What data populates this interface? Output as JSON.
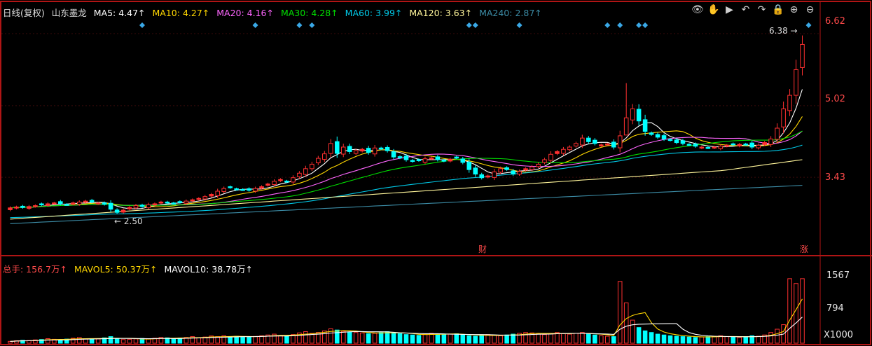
{
  "header": {
    "period": "日线(复权)",
    "stock_name": "山东墨龙",
    "ma": [
      {
        "label": "MA5: 4.47↑",
        "color": "#ffffff"
      },
      {
        "label": "MA10: 4.27↑",
        "color": "#ffd700"
      },
      {
        "label": "MA20: 4.16↑",
        "color": "#ff66ff"
      },
      {
        "label": "MA30: 4.28↑",
        "color": "#00e000"
      },
      {
        "label": "MA60: 3.99↑",
        "color": "#00c8e6"
      },
      {
        "label": "MA120: 3.63↑",
        "color": "#fff59a"
      },
      {
        "label": "MA240: 2.87↑",
        "color": "#3c8ca6"
      }
    ]
  },
  "toolbar": {
    "icons": [
      "eye-icon",
      "hand-icon",
      "play-icon",
      "undo-icon",
      "redo-icon",
      "lock-icon",
      "zoom-in-icon",
      "zoom-out-icon"
    ]
  },
  "price_axis": {
    "ticks": [
      "6.62",
      "5.02",
      "3.43"
    ]
  },
  "annotations": {
    "high_price": "6.38",
    "low_price": "2.50",
    "marker_cai": "财",
    "marker_zhang": "涨"
  },
  "volume": {
    "legend": [
      {
        "label": "总手: 156.7万↑",
        "color": "#ff4a4a"
      },
      {
        "label": "MAVOL5: 50.37万↑",
        "color": "#ffd700"
      },
      {
        "label": "MAVOL10: 38.78万↑",
        "color": "#ffffff"
      }
    ],
    "ticks": [
      "1567",
      "794",
      "X1000"
    ]
  },
  "chart_data": {
    "type": "candlestick",
    "price_ylim": [
      2.0,
      6.9
    ],
    "volume_ylim": [
      0,
      1650
    ],
    "colors": {
      "up": "#ff3030",
      "down": "#00ffff",
      "background": "#000000"
    },
    "diamond_markers": [
      21,
      39,
      46,
      48,
      73,
      74,
      81,
      95,
      97,
      100,
      101,
      127
    ],
    "closes": [
      2.75,
      2.77,
      2.76,
      2.78,
      2.8,
      2.82,
      2.84,
      2.86,
      2.84,
      2.82,
      2.86,
      2.88,
      2.9,
      2.88,
      2.86,
      2.83,
      2.72,
      2.65,
      2.7,
      2.76,
      2.8,
      2.78,
      2.82,
      2.84,
      2.88,
      2.86,
      2.85,
      2.87,
      2.9,
      2.93,
      2.96,
      3.0,
      3.05,
      3.12,
      3.18,
      3.2,
      3.16,
      3.15,
      3.14,
      3.18,
      3.22,
      3.28,
      3.34,
      3.38,
      3.33,
      3.42,
      3.52,
      3.62,
      3.72,
      3.85,
      3.95,
      4.18,
      3.96,
      4.1,
      4.0,
      4.02,
      4.05,
      3.98,
      4.08,
      4.06,
      4.02,
      3.88,
      3.86,
      3.82,
      3.78,
      3.8,
      3.84,
      3.86,
      3.82,
      3.79,
      3.83,
      3.86,
      3.76,
      3.6,
      3.5,
      3.42,
      3.46,
      3.55,
      3.62,
      3.6,
      3.5,
      3.56,
      3.62,
      3.66,
      3.72,
      3.82,
      3.94,
      4.0,
      4.05,
      4.1,
      4.18,
      4.3,
      4.22,
      4.18,
      4.15,
      4.17,
      4.1,
      4.35,
      4.75,
      4.95,
      4.68,
      4.45,
      4.38,
      4.32,
      4.28,
      4.25,
      4.2,
      4.18,
      4.15,
      4.12,
      4.1,
      4.08,
      4.1,
      4.12,
      4.14,
      4.15,
      4.16,
      4.15,
      4.1,
      4.14,
      4.2,
      4.28,
      4.52,
      4.95,
      5.25,
      5.82,
      6.38
    ],
    "volumes": [
      45,
      60,
      70,
      65,
      80,
      90,
      110,
      95,
      85,
      100,
      120,
      140,
      110,
      95,
      105,
      130,
      160,
      110,
      90,
      95,
      105,
      115,
      100,
      120,
      140,
      130,
      115,
      125,
      140,
      160,
      130,
      150,
      175,
      160,
      180,
      155,
      170,
      160,
      150,
      165,
      180,
      200,
      220,
      190,
      170,
      210,
      250,
      280,
      240,
      260,
      300,
      350,
      320,
      290,
      270,
      260,
      250,
      230,
      240,
      260,
      280,
      250,
      230,
      210,
      200,
      190,
      220,
      240,
      230,
      210,
      220,
      230,
      200,
      180,
      170,
      190,
      210,
      190,
      180,
      200,
      220,
      240,
      260,
      250,
      230,
      210,
      240,
      260,
      230,
      220,
      240,
      260,
      220,
      200,
      180,
      170,
      160,
      1500,
      980,
      560,
      380,
      300,
      260,
      220,
      200,
      180,
      170,
      160,
      150,
      140,
      150,
      160,
      170,
      180,
      160,
      150,
      140,
      160,
      180,
      170,
      200,
      260,
      340,
      450,
      1567,
      1450,
      1567
    ],
    "ma_lines": [
      {
        "name": "MA5",
        "color": "#ffffff"
      },
      {
        "name": "MA10",
        "color": "#ffd700"
      },
      {
        "name": "MA20",
        "color": "#ff66ff"
      },
      {
        "name": "MA30",
        "color": "#00e000"
      },
      {
        "name": "MA60",
        "color": "#00c8e6"
      },
      {
        "name": "MA120",
        "color": "#fff59a"
      },
      {
        "name": "MA240",
        "color": "#3c8ca6"
      }
    ]
  }
}
